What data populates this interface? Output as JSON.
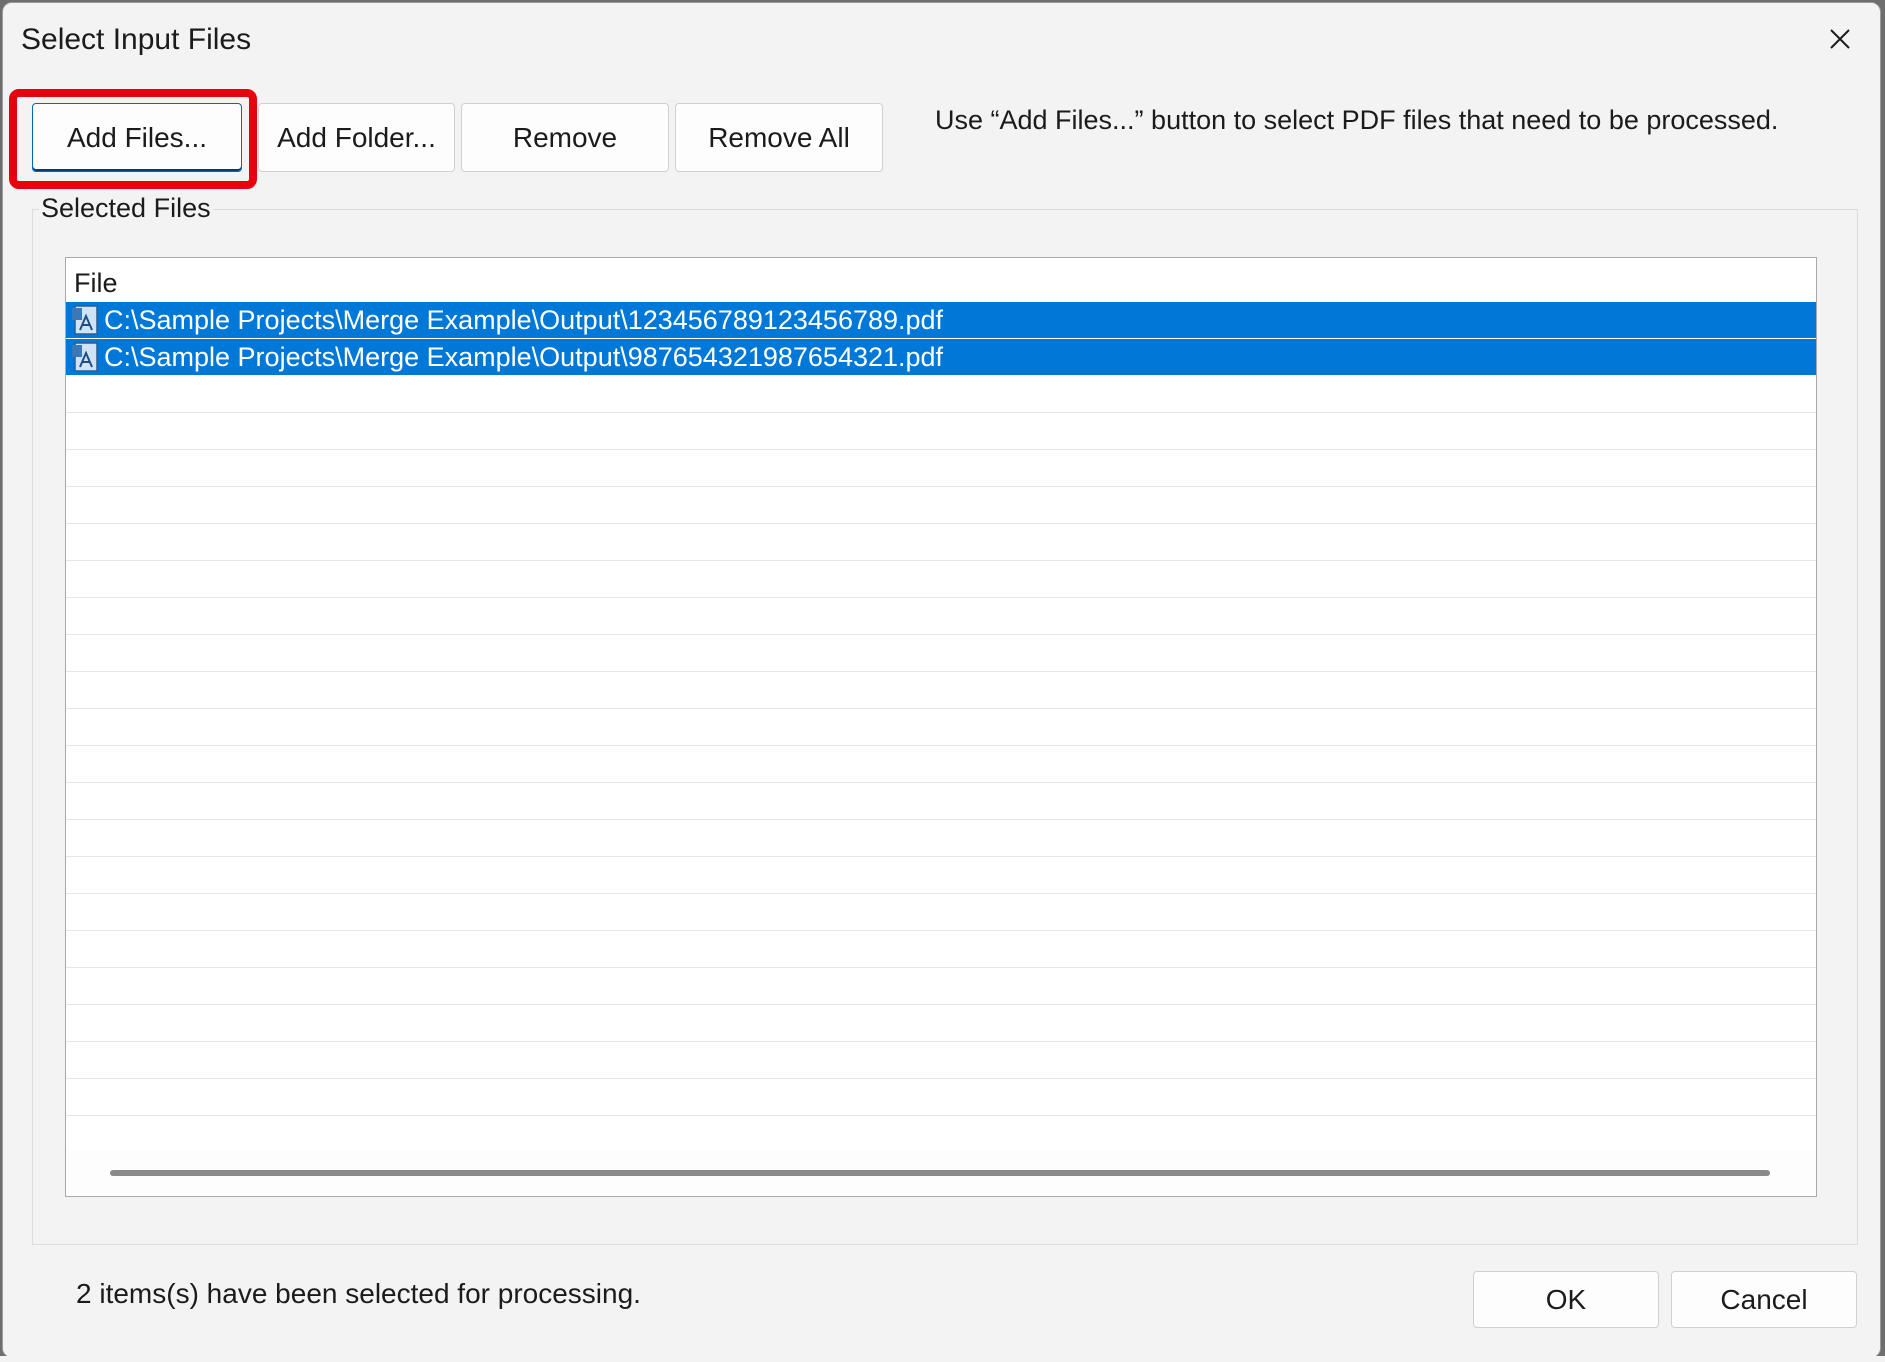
{
  "window": {
    "title": "Select Input Files",
    "close_icon": "close-icon"
  },
  "toolbar": {
    "add_files_label": "Add Files...",
    "add_folder_label": "Add Folder...",
    "remove_label": "Remove",
    "remove_all_label": "Remove All",
    "hint": "Use “Add Files...” button to select PDF files that need to be processed."
  },
  "selected_files": {
    "group_label": "Selected Files",
    "column_header": "File",
    "rows": [
      {
        "path": "C:\\Sample Projects\\Merge Example\\Output\\123456789123456789.pdf",
        "icon": "pdf-file-icon",
        "selected": true
      },
      {
        "path": "C:\\Sample Projects\\Merge Example\\Output\\987654321987654321.pdf",
        "icon": "pdf-file-icon",
        "selected": true
      }
    ],
    "selection_color": "#0078d7"
  },
  "footer": {
    "status": "2 items(s) have been selected for processing.",
    "ok_label": "OK",
    "cancel_label": "Cancel"
  },
  "annotation": {
    "highlight_color": "#e8000e"
  }
}
